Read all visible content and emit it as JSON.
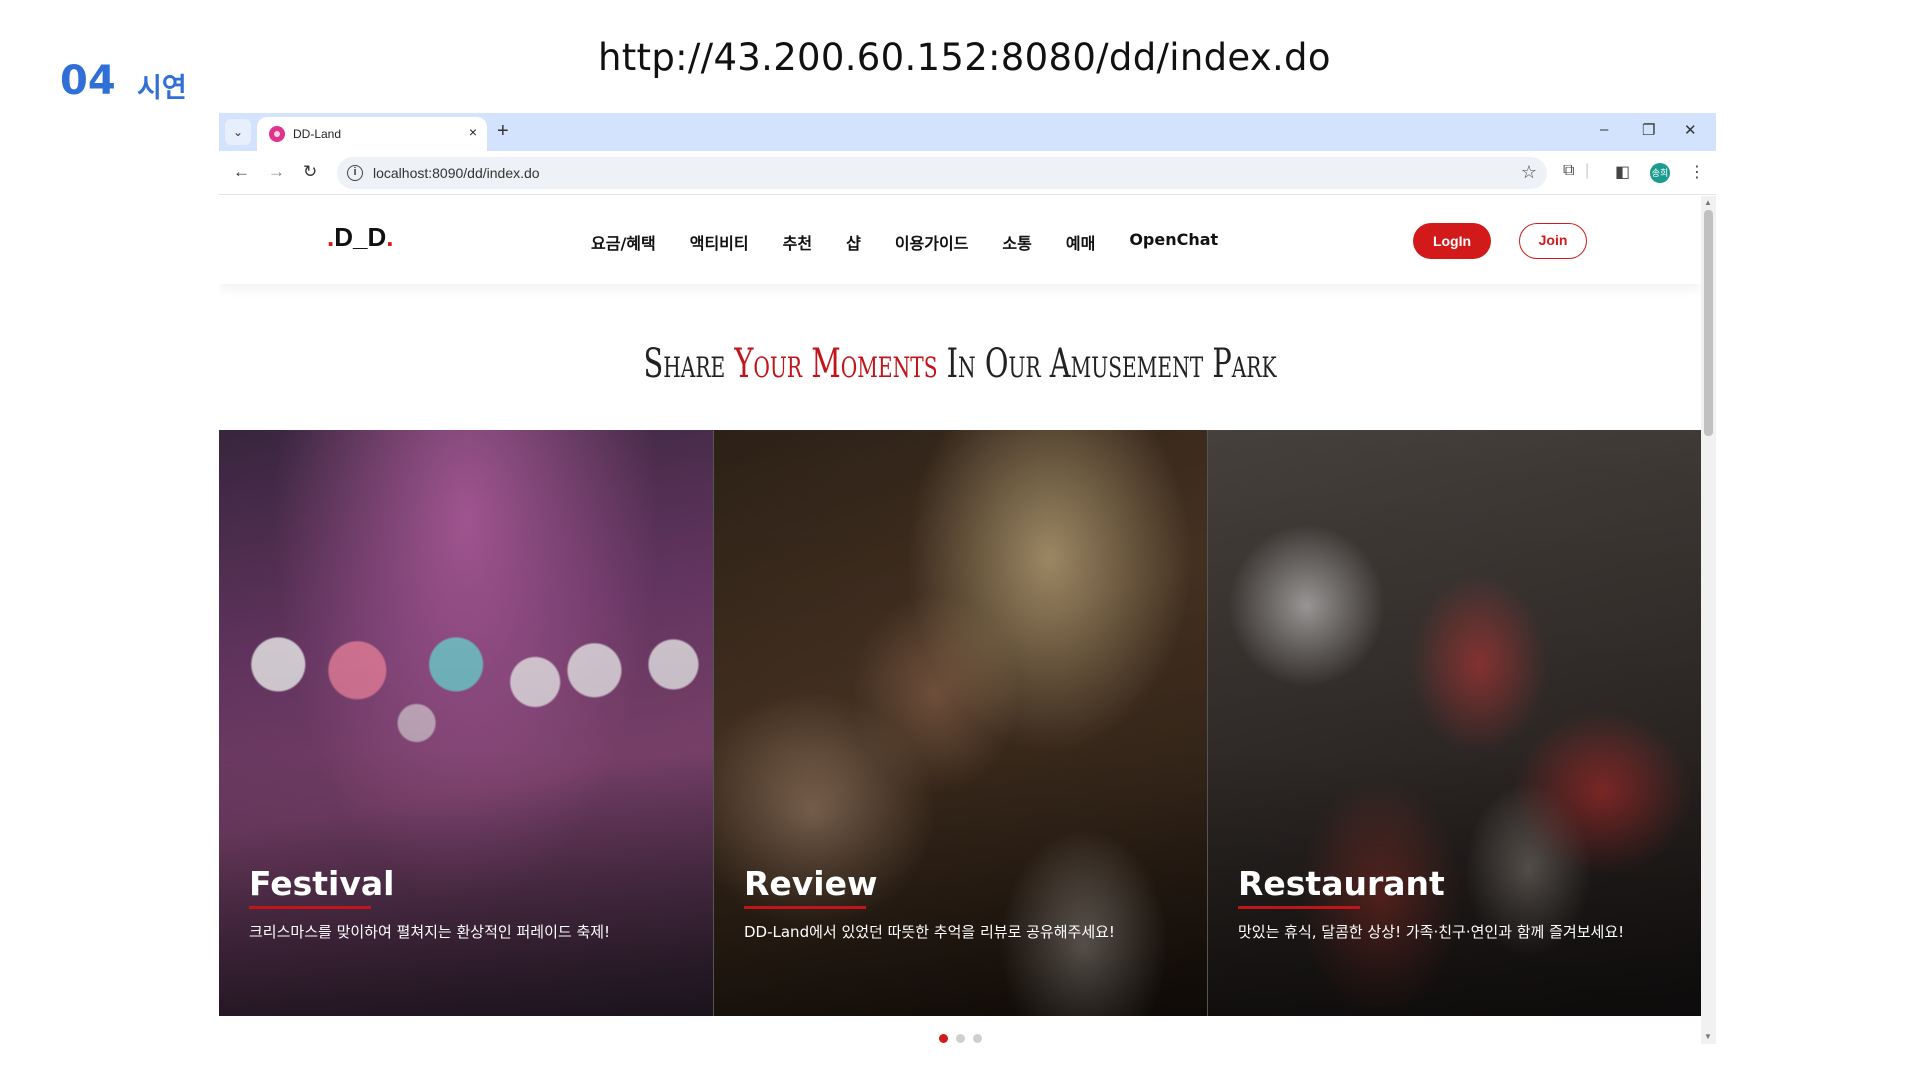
{
  "slide": {
    "number": "04",
    "title": "시연",
    "url_caption": "http://43.200.60.152:8080/dd/index.do"
  },
  "browser": {
    "tab_title": "DD-Land",
    "tab_close": "×",
    "new_tab": "+",
    "omnibox_url": "localhost:8090/dd/index.do",
    "avatar_text": "송희",
    "window_controls": {
      "minimize": "–",
      "restore": "❐",
      "close": "✕"
    }
  },
  "site": {
    "logo": {
      "dot1": ".",
      "main": "D_D",
      "dot2": "."
    },
    "menu": [
      "요금/혜택",
      "액티비티",
      "추천",
      "샵",
      "이용가이드",
      "소통",
      "예매",
      "OpenChat"
    ],
    "login_label": "LogIn",
    "join_label": "Join",
    "headline": {
      "part1": "Share",
      "accent": "Your Moments",
      "part2": "In Our Amusement Park"
    },
    "cards": [
      {
        "title": "Festival",
        "desc": "크리스마스를 맞이하여 펼쳐지는 환상적인 퍼레이드 축제!"
      },
      {
        "title": "Review",
        "desc": "DD-Land에서 있었던 따뜻한 추억을 리뷰로 공유해주세요!"
      },
      {
        "title": "Restaurant",
        "desc": "맛있는 휴식, 달콤한 상상! 가족·친구·연인과 함께 즐겨보세요!"
      }
    ],
    "carousel_active": 1,
    "carousel_count": 3
  },
  "colors": {
    "accent": "#d21a1a",
    "slide_blue": "#2f6fd6",
    "tabstrip": "#d3e3fd"
  },
  "icons": [
    "tab-list-icon",
    "favicon-icon",
    "back-icon",
    "forward-icon",
    "reload-icon",
    "site-info-icon",
    "bookmark-star-icon",
    "extensions-icon",
    "side-panel-icon",
    "more-menu-icon"
  ]
}
